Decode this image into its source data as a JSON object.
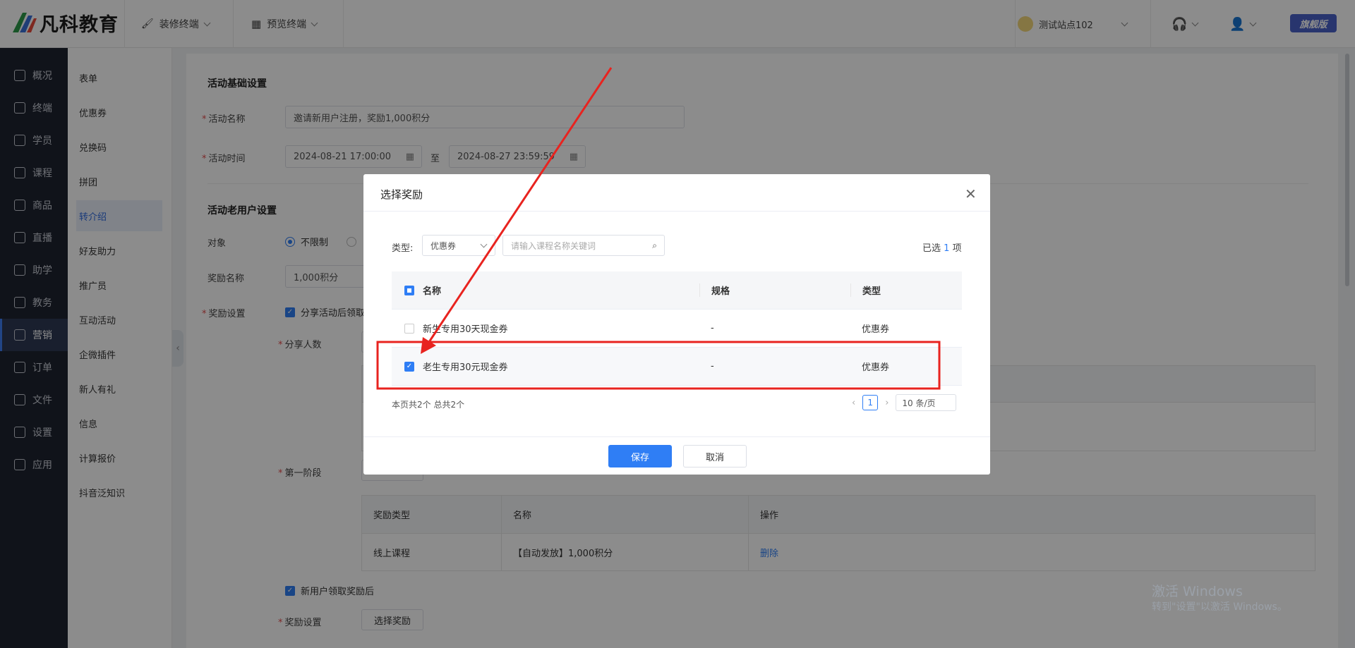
{
  "header": {
    "brand": "凡科教育",
    "menu_decorate": "装修终端",
    "menu_preview": "预览终端",
    "site_name": "测试站点102",
    "edition_badge": "旗舰版"
  },
  "sidebar": {
    "items": [
      {
        "label": "概况",
        "icon": "grid-icon"
      },
      {
        "label": "终端",
        "icon": "store-icon"
      },
      {
        "label": "学员",
        "icon": "users-icon"
      },
      {
        "label": "课程",
        "icon": "course-icon"
      },
      {
        "label": "商品",
        "icon": "goods-icon"
      },
      {
        "label": "直播",
        "icon": "live-icon"
      },
      {
        "label": "助学",
        "icon": "assist-icon"
      },
      {
        "label": "教务",
        "icon": "book-icon"
      },
      {
        "label": "营销",
        "icon": "marketing-icon"
      },
      {
        "label": "订单",
        "icon": "order-icon"
      },
      {
        "label": "文件",
        "icon": "folder-icon"
      },
      {
        "label": "设置",
        "icon": "settings-icon"
      },
      {
        "label": "应用",
        "icon": "apps-icon"
      }
    ],
    "active": "营销"
  },
  "submenu": {
    "items": [
      "表单",
      "优惠券",
      "兑换码",
      "拼团",
      "转介绍",
      "好友助力",
      "推广员",
      "互动活动",
      "企微插件",
      "新人有礼",
      "信息",
      "计算报价",
      "抖音泛知识"
    ],
    "active": "转介绍"
  },
  "form": {
    "section_basic": "活动基础设置",
    "name_label": "活动名称",
    "name_value": "邀请新用户注册，奖励1,000积分",
    "time_label": "活动时间",
    "time_start": "2024-08-21 17:00:00",
    "time_sep": "至",
    "time_end": "2024-08-27 23:59:59",
    "section_old": "活动老用户设置",
    "target_label": "对象",
    "target_option": "不限制",
    "reward_name_label": "奖励名称",
    "reward_name_value": "1,000积分",
    "reward_setting_label": "奖励设置",
    "share_after_label": "分享活动后领取",
    "share_count_label": "分享人数",
    "stage_label": "第一阶段",
    "new_user_label": "新用户领取奖励后",
    "reward_setting_label2": "奖励设置",
    "choose_reward_btn": "选择奖励"
  },
  "reward_table": {
    "headers": [
      "奖励类型",
      "名称",
      "操作"
    ],
    "rows": [
      {
        "type": "线上课程",
        "name": "【自动发放】1,000积分",
        "action": "删除"
      }
    ]
  },
  "dialog": {
    "title": "选择奖励",
    "type_label": "类型:",
    "type_value": "优惠券",
    "search_placeholder": "请输入课程名称关键词",
    "selected_prefix": "已选",
    "selected_count": "1",
    "selected_suffix": "项",
    "table_headers": [
      "名称",
      "规格",
      "类型"
    ],
    "rows": [
      {
        "name": "新生专用30天现金券",
        "spec": "-",
        "type": "优惠券",
        "checked": false
      },
      {
        "name": "老生专用30元现金券",
        "spec": "-",
        "type": "优惠券",
        "checked": true
      }
    ],
    "summary": "本页共2个 总共2个",
    "page": "1",
    "page_size": "10 条/页",
    "save_btn": "保存",
    "cancel_btn": "取消"
  },
  "watermark": {
    "line1": "激活 Windows",
    "line2": "转到\"设置\"以激活 Windows。"
  },
  "colors": {
    "accent": "#2f7ef5",
    "sidebar_bg": "#1e2330",
    "annotation_red": "#e8231f"
  }
}
